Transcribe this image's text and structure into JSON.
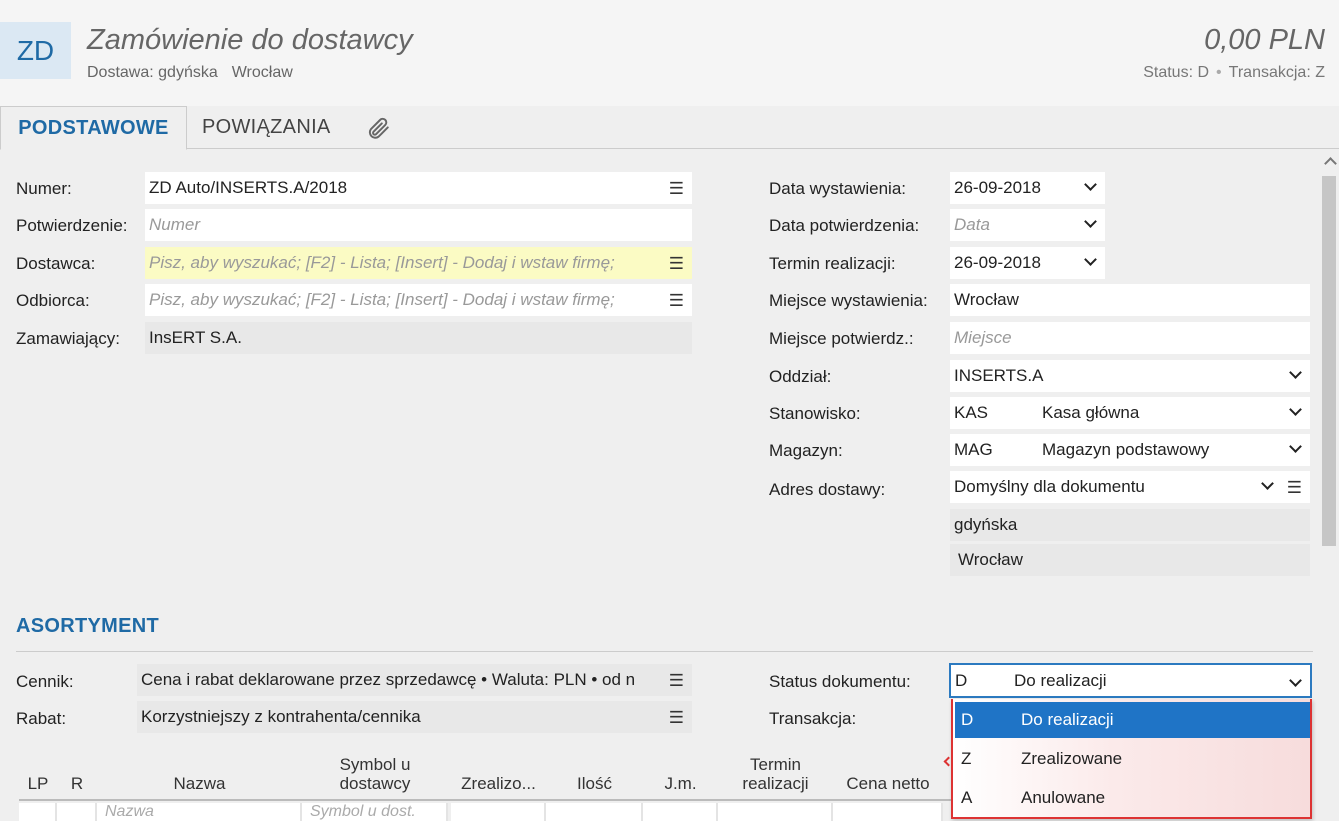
{
  "header": {
    "badge": "ZD",
    "title": "Zamówienie do dostawcy",
    "subtitle_left": "Dostawa: gdyńska",
    "subtitle_right": "Wrocław",
    "amount": "0,00 PLN",
    "status_label": "Status:",
    "status_value": "D",
    "transaction_label": "Transakcja:",
    "transaction_value": "Z"
  },
  "tabs": [
    {
      "label": "PODSTAWOWE",
      "active": true
    },
    {
      "label": "POWIĄZANIA",
      "active": false
    },
    {
      "label": "",
      "icon": "paperclip-icon"
    }
  ],
  "left_form": {
    "numer": {
      "label": "Numer:",
      "value": "ZD Auto/INSERTS.A/2018"
    },
    "potwierdzenie": {
      "label": "Potwierdzenie:",
      "placeholder": "Numer"
    },
    "dostawca": {
      "label": "Dostawca:",
      "placeholder": "Pisz, aby wyszukać; [F2] - Lista; [Insert] - Dodaj i wstaw firmę;"
    },
    "odbiorca": {
      "label": "Odbiorca:",
      "placeholder": "Pisz, aby wyszukać; [F2] - Lista; [Insert] - Dodaj i wstaw firmę;"
    },
    "zamawiajacy": {
      "label": "Zamawiający:",
      "value": "InsERT S.A."
    }
  },
  "right_form": {
    "data_wystawienia": {
      "label": "Data wystawienia:",
      "value": "26-09-2018"
    },
    "data_potwierdzenia": {
      "label": "Data potwierdzenia:",
      "placeholder": "Data"
    },
    "termin_realizacji": {
      "label": "Termin realizacji:",
      "value": "26-09-2018"
    },
    "miejsce_wystawienia": {
      "label": "Miejsce wystawienia:",
      "value": "Wrocław"
    },
    "miejsce_potwierdz": {
      "label": "Miejsce potwierdz.:",
      "placeholder": "Miejsce"
    },
    "oddzial": {
      "label": "Oddział:",
      "value": "INSERTS.A"
    },
    "stanowisko": {
      "label": "Stanowisko:",
      "code": "KAS",
      "name": "Kasa główna"
    },
    "magazyn": {
      "label": "Magazyn:",
      "code": "MAG",
      "name": "Magazyn podstawowy"
    },
    "adres_dostawy": {
      "label": "Adres dostawy:",
      "value": "Domyślny dla dokumentu",
      "line1": "gdyńska",
      "line2": "Wrocław"
    }
  },
  "asortyment": {
    "title": "ASORTYMENT",
    "cennik": {
      "label": "Cennik:",
      "value": "Cena i rabat deklarowane przez sprzedawcę • Waluta: PLN • od n"
    },
    "rabat": {
      "label": "Rabat:",
      "value": "Korzystniejszy z kontrahenta/cennika"
    },
    "status_dokumentu": {
      "label": "Status dokumentu:",
      "code": "D",
      "name": "Do realizacji"
    },
    "transakcja": {
      "label": "Transakcja:"
    }
  },
  "status_options": [
    {
      "code": "D",
      "name": "Do realizacji",
      "selected": true
    },
    {
      "code": "Z",
      "name": "Zrealizowane",
      "selected": false
    },
    {
      "code": "A",
      "name": "Anulowane",
      "selected": false
    }
  ],
  "table": {
    "columns": [
      "LP",
      "R",
      "Nazwa",
      "Symbol u dostawcy",
      "Zrealizo...",
      "Ilość",
      "J.m.",
      "Termin realizacji",
      "Cena netto"
    ],
    "new_row": {
      "nazwa": "Nazwa",
      "symbol": "Symbol u dost."
    }
  },
  "colors": {
    "accent": "#1f6aa5",
    "selected": "#1f74c6",
    "error": "#dd3333",
    "highlight": "#fbfbc4"
  }
}
